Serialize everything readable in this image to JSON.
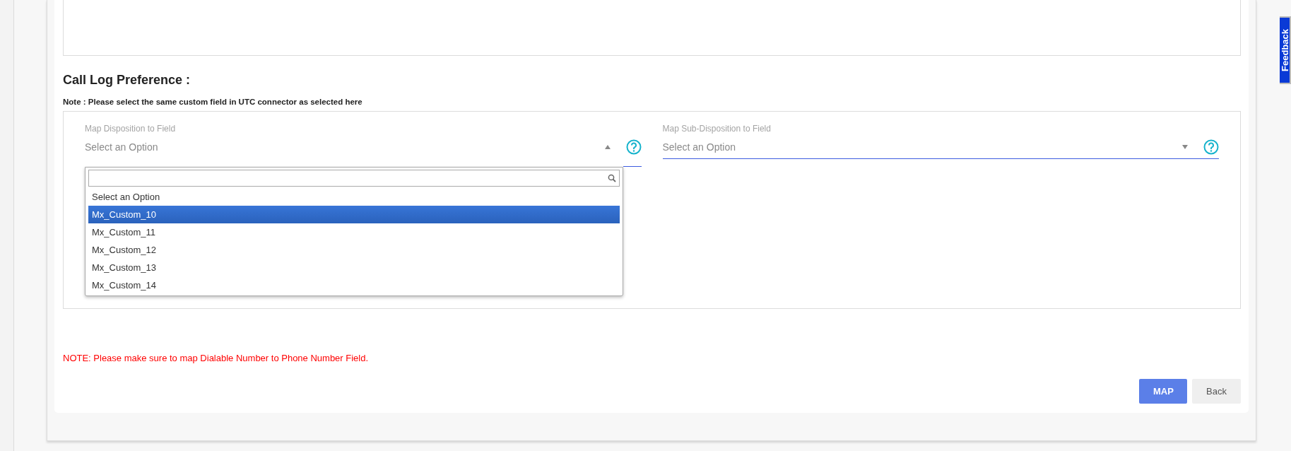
{
  "section": {
    "title": "Call Log Preference :",
    "note": "Note : Please select the same custom field in UTC connector as selected here"
  },
  "fields": [
    {
      "label": "Map Disposition to Field",
      "value": "Select an Option",
      "expanded": true
    },
    {
      "label": "Map Sub-Disposition to Field",
      "value": "Select an Option",
      "expanded": false
    }
  ],
  "dropdown": {
    "options": [
      {
        "label": "Select an Option",
        "selected": false
      },
      {
        "label": "Mx_Custom_10",
        "selected": true
      },
      {
        "label": "Mx_Custom_11",
        "selected": false
      },
      {
        "label": "Mx_Custom_12",
        "selected": false
      },
      {
        "label": "Mx_Custom_13",
        "selected": false
      },
      {
        "label": "Mx_Custom_14",
        "selected": false
      }
    ]
  },
  "warning": "NOTE: Please make sure to map Dialable Number to Phone Number Field.",
  "buttons": [
    {
      "label": "MAP",
      "kind": "primary"
    },
    {
      "label": "Back",
      "kind": "secondary"
    }
  ],
  "feedback": "Feedback"
}
